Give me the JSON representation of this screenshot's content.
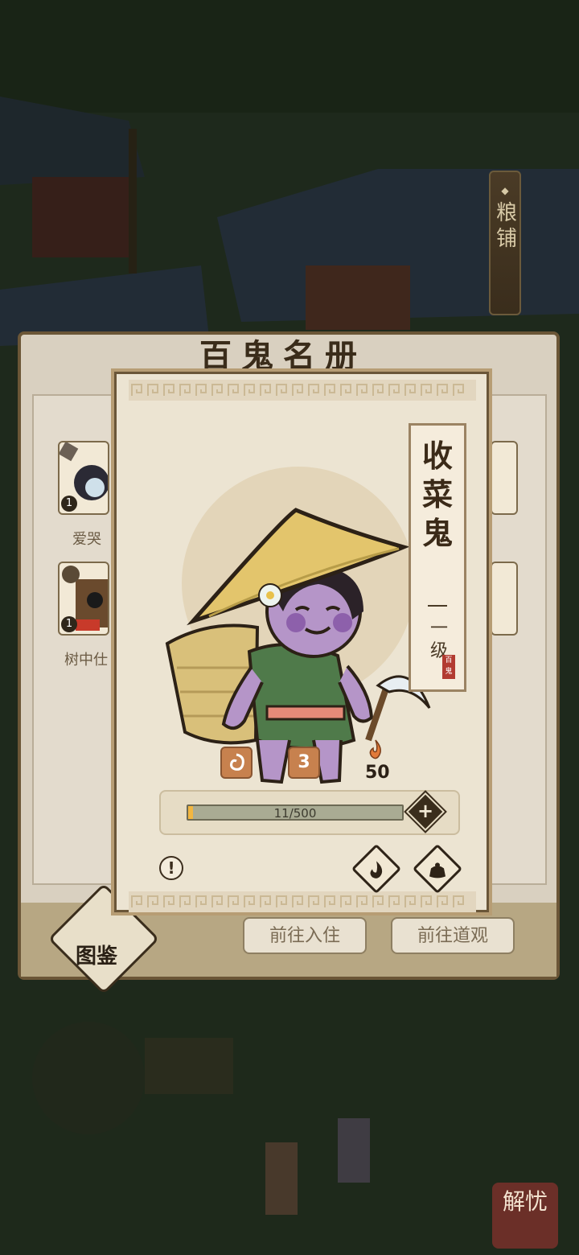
{
  "shop_sign": {
    "label": "粮铺"
  },
  "roster_panel": {
    "title": "百鬼名册",
    "tiles": [
      {
        "label": "爱哭",
        "level": "1"
      },
      {
        "label": "树中仕",
        "level": "1"
      }
    ],
    "codex_label": "图鉴",
    "goto_residence_label": "前往入住",
    "goto_temple_label": "前往道观"
  },
  "ghost_card": {
    "name": "收菜鬼",
    "rank": "一级",
    "seal_text": "百鬼",
    "stats": {
      "badge_a": "",
      "badge_b": "3",
      "flame_value": "50"
    },
    "xp": {
      "current": 11,
      "max": 500,
      "text": "11/500"
    }
  },
  "corner_button": {
    "label": "解忧"
  },
  "colors": {
    "card_border": "#b79d74",
    "xp_fill": "#f2b640",
    "seal": "#b23b31"
  }
}
